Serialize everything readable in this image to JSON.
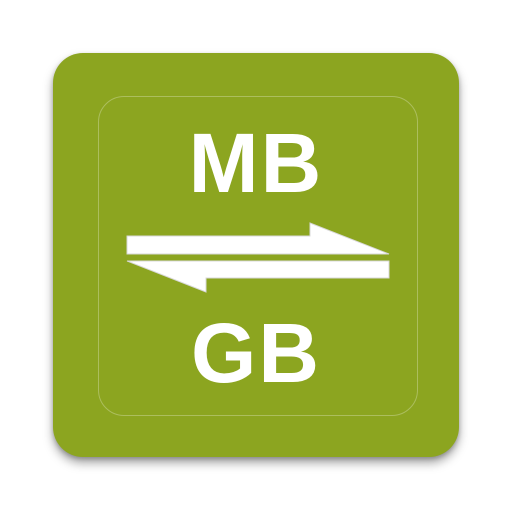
{
  "icon": {
    "top_label": "MB",
    "bottom_label": "GB",
    "symbol": "swap-arrows-icon",
    "colors": {
      "background": "#8ca520",
      "foreground": "#ffffff"
    }
  }
}
